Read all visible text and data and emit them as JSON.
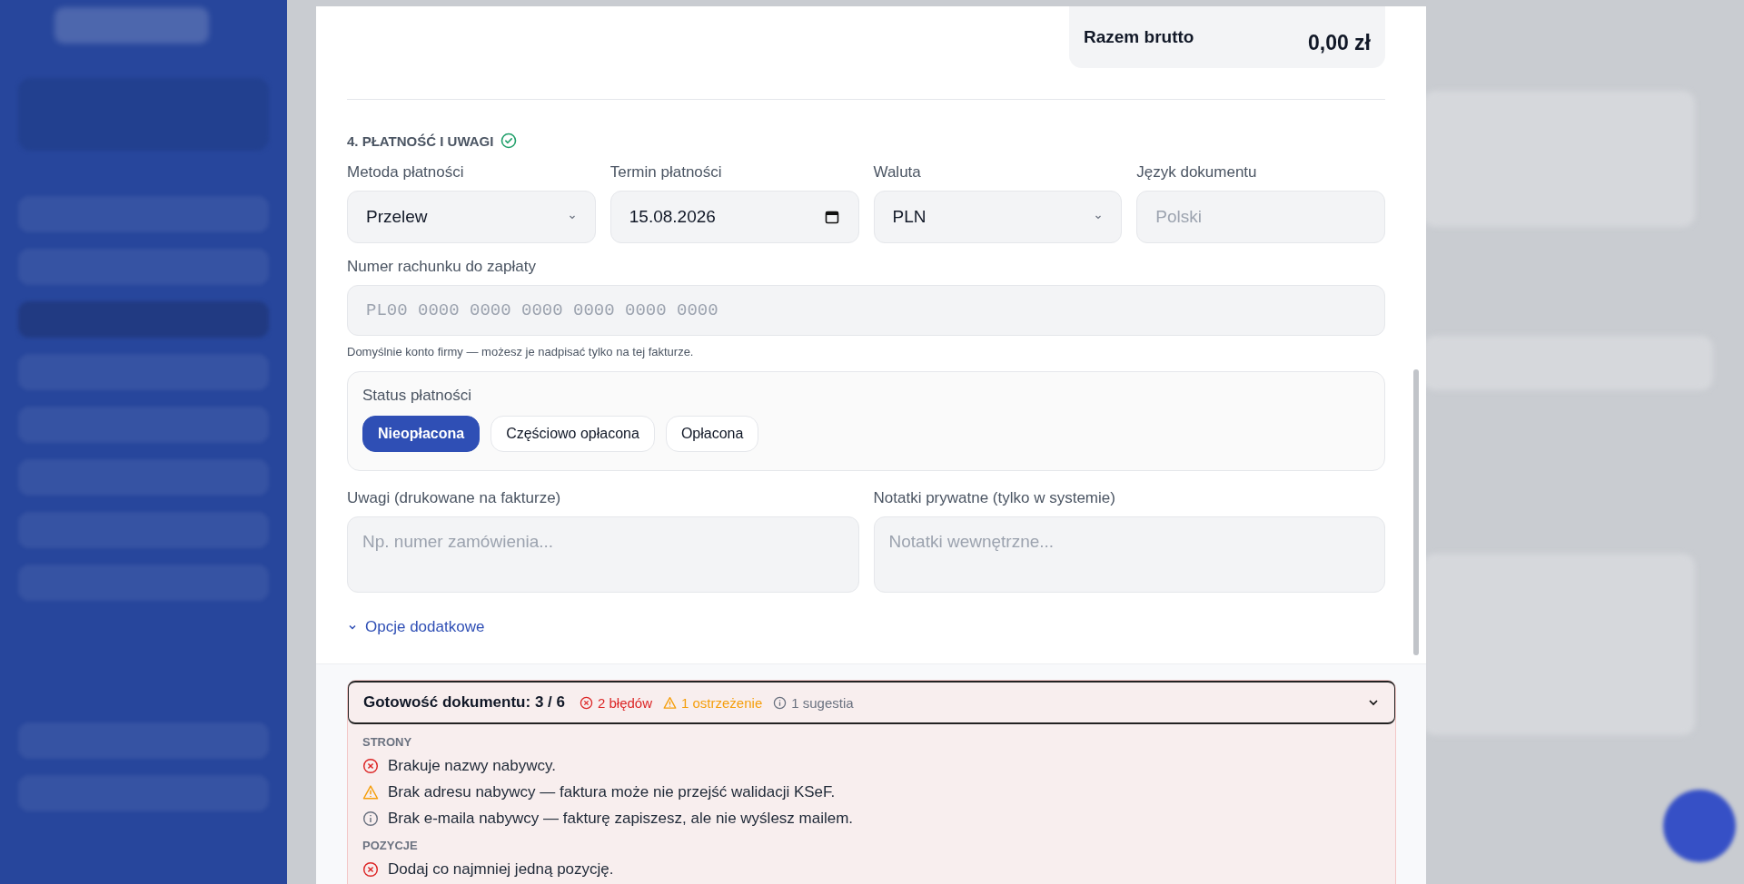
{
  "summary": {
    "label": "Razem brutto",
    "value": "0,00 zł"
  },
  "section": {
    "title": "4. PŁATNOŚĆ I UWAGI",
    "complete": true
  },
  "fields": [
    {
      "kind": "select",
      "label": "Metoda płatności",
      "value": "Przelew"
    },
    {
      "kind": "date",
      "label": "Termin płatności",
      "value": "15.08.2026"
    },
    {
      "kind": "select",
      "label": "Waluta",
      "value": "PLN"
    },
    {
      "kind": "text",
      "label": "Język dokumentu",
      "placeholder": "Polski"
    }
  ],
  "account": {
    "label": "Numer rachunku do zapłaty",
    "placeholder": "PL00 0000 0000 0000 0000 0000 0000",
    "hint": "Domyślnie konto firmy — możesz je nadpisać tylko na tej fakturze."
  },
  "payment_status": {
    "label": "Status płatności",
    "options": [
      {
        "label": "Nieopłacona",
        "selected": true
      },
      {
        "label": "Częściowo opłacona",
        "selected": false
      },
      {
        "label": "Opłacona",
        "selected": false
      }
    ]
  },
  "notes": [
    {
      "label": "Uwagi (drukowane na fakturze)",
      "placeholder": "Np. numer zamówienia..."
    },
    {
      "label": "Notatki prywatne (tylko w systemie)",
      "placeholder": "Notatki wewnętrzne..."
    }
  ],
  "more_options": {
    "label": "Opcje dodatkowe",
    "expanded": false
  },
  "readiness": {
    "title": "Gotowość dokumentu: 3 / 6",
    "expanded": true,
    "counts": [
      {
        "kind": "error",
        "text": "2 błędów"
      },
      {
        "kind": "warning",
        "text": "1 ostrzeżenie"
      },
      {
        "kind": "info",
        "text": "1 sugestia"
      }
    ],
    "groups": [
      {
        "title": "STRONY",
        "items": [
          {
            "kind": "error",
            "text": "Brakuje nazwy nabywcy."
          },
          {
            "kind": "warning",
            "text": "Brak adresu nabywcy — faktura może nie przejść walidacji KSeF."
          },
          {
            "kind": "info",
            "text": "Brak e-maila nabywcy — fakturę zapiszesz, ale nie wyślesz mailem."
          }
        ]
      },
      {
        "title": "POZYCJE",
        "items": [
          {
            "kind": "error",
            "text": "Dodaj co najmniej jedną pozycję."
          }
        ]
      }
    ]
  }
}
